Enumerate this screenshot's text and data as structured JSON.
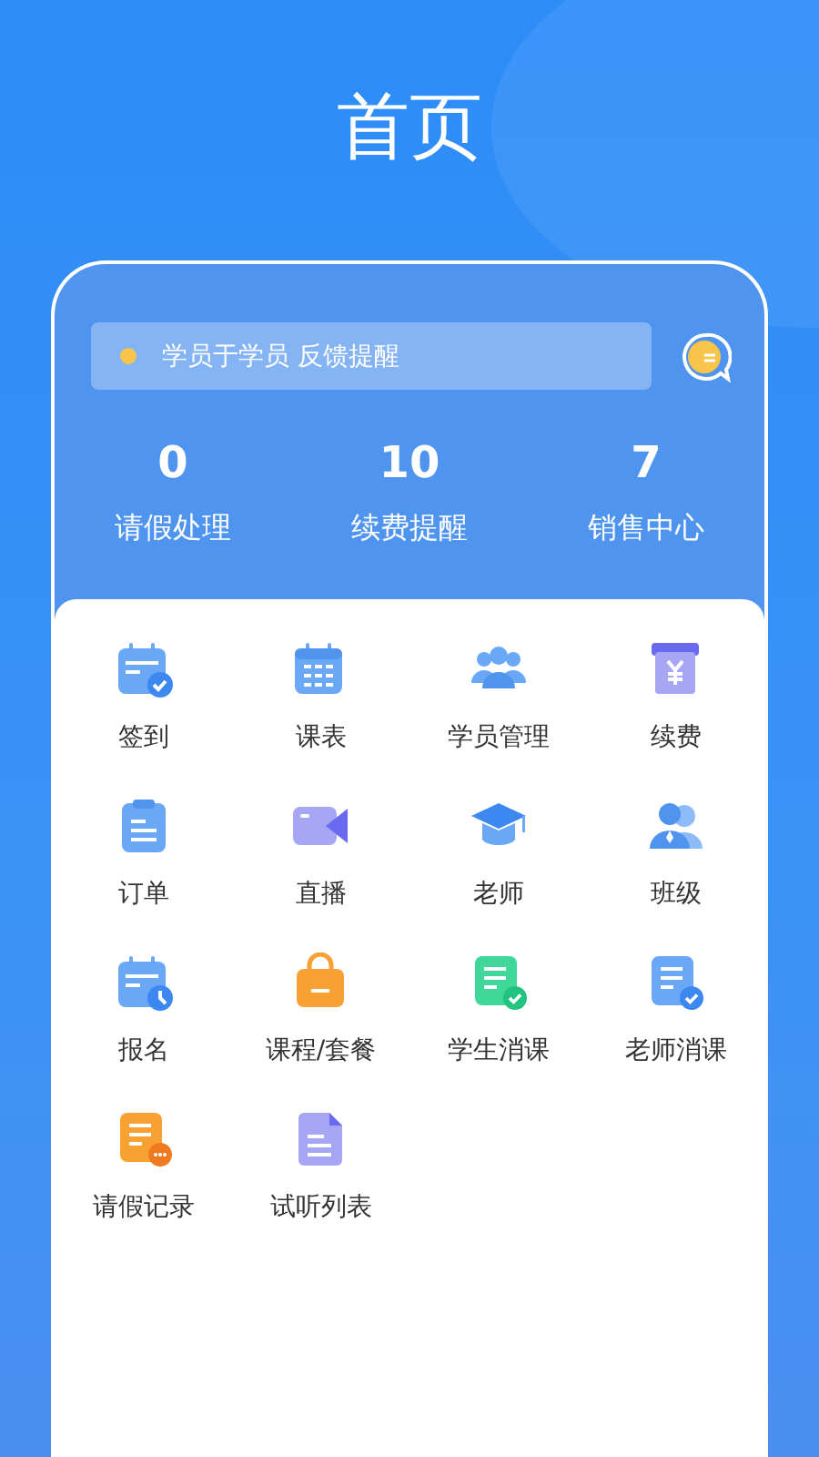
{
  "title": "首页",
  "notice": {
    "text": "学员于学员 反馈提醒"
  },
  "stats": [
    {
      "value": "0",
      "label": "请假处理"
    },
    {
      "value": "10",
      "label": "续费提醒"
    },
    {
      "value": "7",
      "label": "销售中心"
    }
  ],
  "menu": [
    {
      "label": "签到",
      "kind": "checkin"
    },
    {
      "label": "课表",
      "kind": "calendar"
    },
    {
      "label": "学员管理",
      "kind": "people"
    },
    {
      "label": "续费",
      "kind": "fee"
    },
    {
      "label": "订单",
      "kind": "clipboard"
    },
    {
      "label": "直播",
      "kind": "video"
    },
    {
      "label": "老师",
      "kind": "graduation"
    },
    {
      "label": "班级",
      "kind": "group"
    },
    {
      "label": "报名",
      "kind": "signup"
    },
    {
      "label": "课程/套餐",
      "kind": "bag"
    },
    {
      "label": "学生消课",
      "kind": "student-done"
    },
    {
      "label": "老师消课",
      "kind": "teacher-done"
    },
    {
      "label": "请假记录",
      "kind": "leave"
    },
    {
      "label": "试听列表",
      "kind": "file"
    }
  ]
}
